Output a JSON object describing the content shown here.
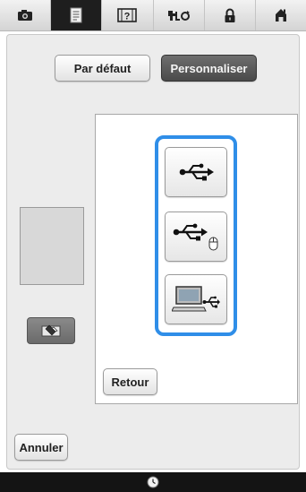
{
  "top_tabs": [
    {
      "icon": "camera-icon",
      "active": false
    },
    {
      "icon": "document-icon",
      "active": true
    },
    {
      "icon": "help-icon",
      "active": false
    },
    {
      "icon": "thread-tension-icon",
      "active": false
    },
    {
      "icon": "lock-icon",
      "active": false
    },
    {
      "icon": "home-icon",
      "active": false
    }
  ],
  "buttons": {
    "default_label": "Par défaut",
    "custom_label": "Personnaliser",
    "back_label": "Retour",
    "cancel_label": "Annuler"
  },
  "usb_options": [
    {
      "icon": "usb-icon"
    },
    {
      "icon": "usb-mouse-icon"
    },
    {
      "icon": "usb-computer-icon"
    }
  ],
  "colors": {
    "selection_border": "#2f8ee8",
    "active_tab": "#1e1e1e",
    "active_button": "#555555"
  },
  "bottom_bar": {
    "icon": "clock-icon"
  }
}
